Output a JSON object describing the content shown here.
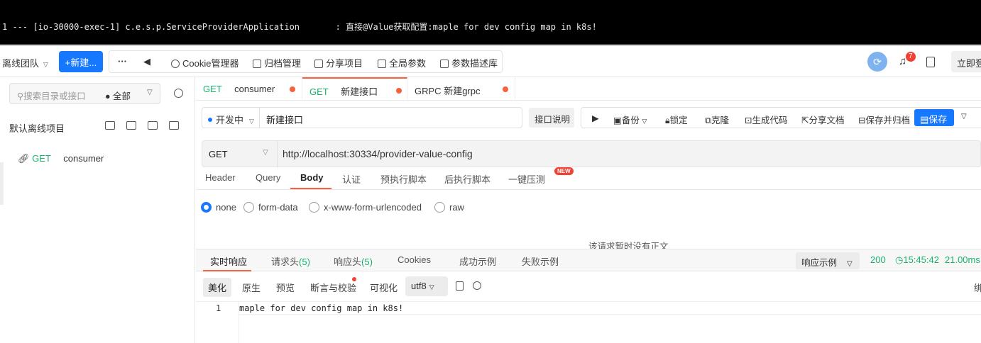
{
  "terminal": {
    "line": "1 --- [io-30000-exec-1] c.e.s.p.ServiceProviderApplication       : 直接@Value获取配置:maple for dev config map in k8s!"
  },
  "topbar": {
    "team": "离线团队",
    "new_button": "+新建...",
    "more": "···",
    "back": "◀",
    "tools": [
      "Cookie管理器",
      "归档管理",
      "分享项目",
      "全局参数",
      "参数描述库"
    ],
    "notification_count": "7",
    "login": "立即登"
  },
  "sidebar": {
    "search_placeholder": "搜索目录或接口",
    "filter": "● 全部",
    "project_title": "默认离线项目",
    "items": [
      {
        "method": "GET",
        "name": "consumer"
      }
    ]
  },
  "tabs": [
    {
      "method": "GET",
      "name": "consumer"
    },
    {
      "method": "GET",
      "name": "新建接口"
    },
    {
      "method": "GRPC",
      "name": "新建grpc"
    }
  ],
  "request": {
    "status": "开发中",
    "name": "新建接口",
    "desc_button": "接口说明",
    "actions": [
      "备份",
      "锁定",
      "克隆",
      "生成代码",
      "分享文档",
      "保存并归档"
    ],
    "save": "保存",
    "method": "GET",
    "url": "http://localhost:30334/provider-value-config"
  },
  "subtabs": [
    "Header",
    "Query",
    "Body",
    "认证",
    "预执行脚本",
    "后执行脚本",
    "一键压测"
  ],
  "new_badge": "NEW",
  "body_types": [
    "none",
    "form-data",
    "x-www-form-urlencoded",
    "raw"
  ],
  "body_selected": "none",
  "empty_body": "该请求暂时没有正文",
  "response": {
    "tabs": [
      "实时响应",
      "请求头",
      "响应头",
      "Cookies",
      "成功示例",
      "失败示例"
    ],
    "req_headers_count": "(5)",
    "resp_headers_count": "(5)",
    "example_select": "响应示例",
    "status_code": "200",
    "time": "15:45:42",
    "duration": "21.00ms",
    "view_tabs": [
      "美化",
      "原生",
      "预览",
      "断言与校验",
      "可视化"
    ],
    "encoding": "utf8",
    "right_cut": "绑",
    "line_number": "1",
    "body": "maple for dev config map in k8s!"
  },
  "colors": {
    "accent": "#1677ff",
    "active_tab": "#f5623d",
    "get_method": "#17b26a",
    "badge": "#f04134"
  }
}
